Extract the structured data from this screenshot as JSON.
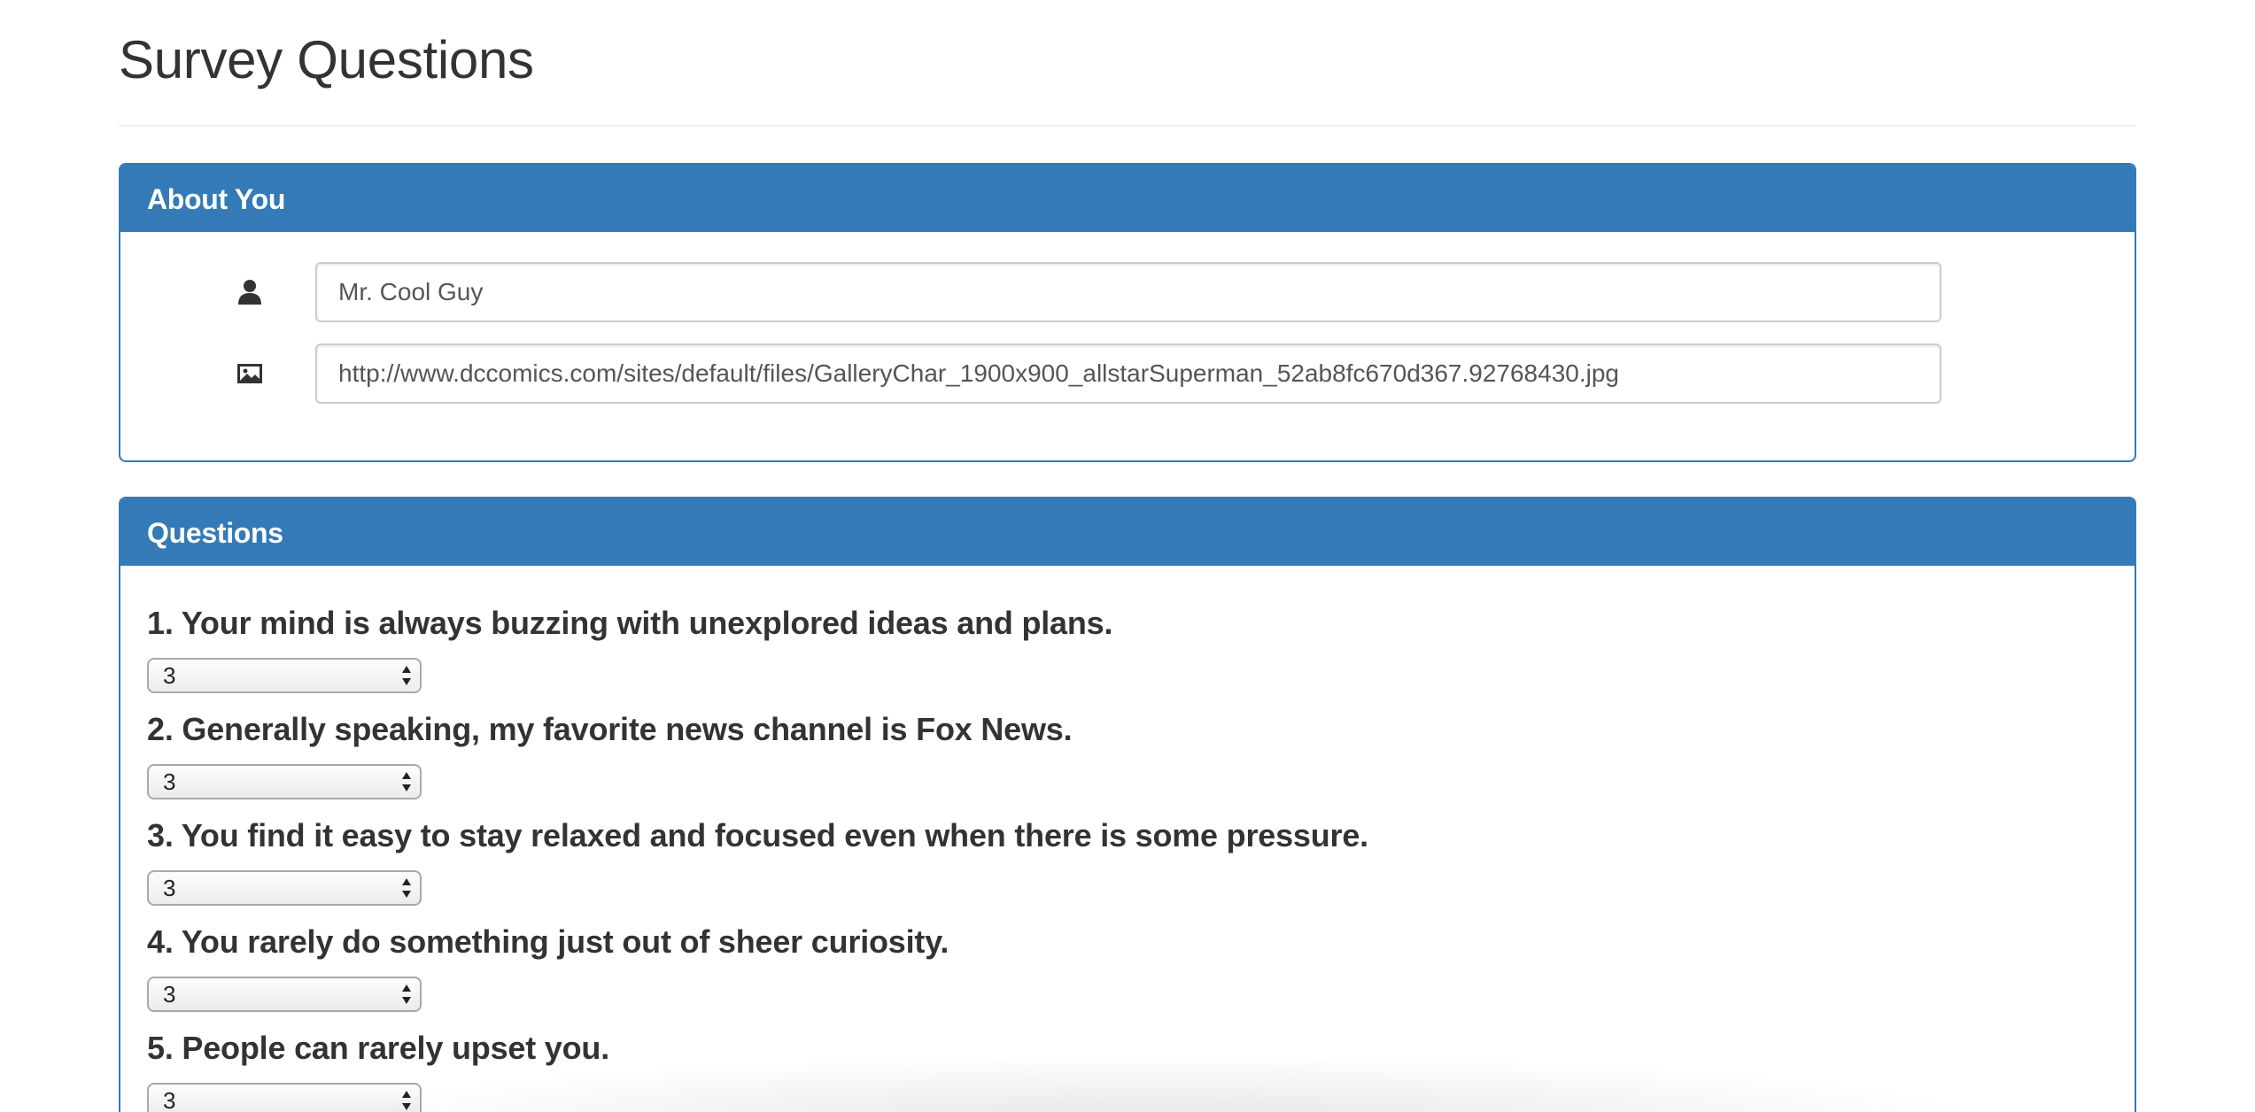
{
  "page": {
    "title": "Survey Questions"
  },
  "about": {
    "heading": "About You",
    "name_value": "Mr. Cool Guy",
    "photo_value": "http://www.dccomics.com/sites/default/files/GalleryChar_1900x900_allstarSuperman_52ab8fc670d367.92768430.jpg",
    "icons": [
      "user-icon",
      "picture-icon"
    ]
  },
  "questions": {
    "heading": "Questions",
    "items": [
      {
        "text": "1. Your mind is always buzzing with unexplored ideas and plans.",
        "value": "3"
      },
      {
        "text": "2. Generally speaking, my favorite news channel is Fox News.",
        "value": "3"
      },
      {
        "text": "3. You find it easy to stay relaxed and focused even when there is some pressure.",
        "value": "3"
      },
      {
        "text": "4. You rarely do something just out of sheer curiosity.",
        "value": "3"
      },
      {
        "text": "5. People can rarely upset you.",
        "value": "3"
      }
    ]
  },
  "colors": {
    "panel_primary": "#337ab7",
    "text": "#333333",
    "input_border": "#cccccc"
  }
}
